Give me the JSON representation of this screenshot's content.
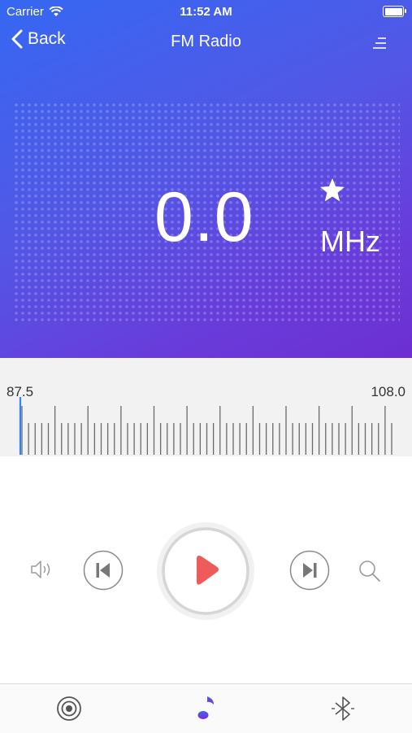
{
  "status_bar": {
    "carrier": "Carrier",
    "time": "11:52 AM"
  },
  "nav": {
    "back_label": "Back",
    "title": "FM Radio"
  },
  "tuner": {
    "frequency": "0.0",
    "unit": "MHz"
  },
  "dial": {
    "min_label": "87.5",
    "max_label": "108.0"
  },
  "controls": {
    "icons": [
      "speaker-icon",
      "skip-previous-icon",
      "play-icon",
      "skip-next-icon",
      "search-icon"
    ]
  },
  "tabbar": {
    "icons": [
      "target-icon",
      "music-note-icon",
      "bluetooth-icon"
    ],
    "active": "music-note-icon"
  },
  "colors": {
    "gradient_start": "#3568f2",
    "gradient_end": "#6c2fd1",
    "play_accent": "#ef5a5a",
    "tick_indicator": "#2e86f5"
  }
}
